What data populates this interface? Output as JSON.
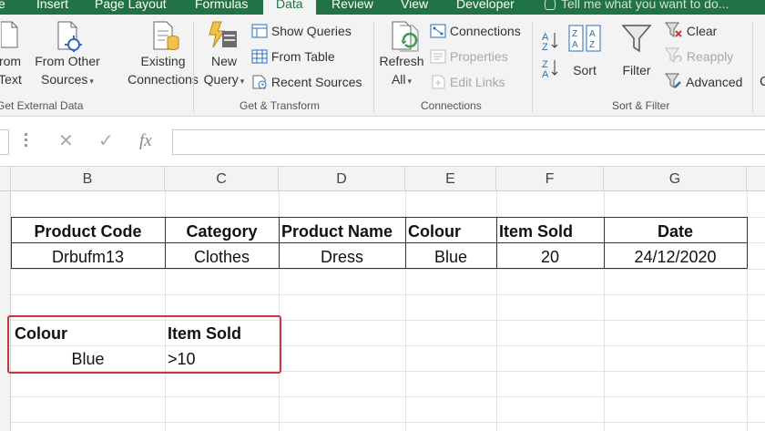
{
  "tabs": [
    {
      "label": "e"
    },
    {
      "label": "Insert"
    },
    {
      "label": "Page Layout"
    },
    {
      "label": "Formulas"
    },
    {
      "label": "Data"
    },
    {
      "label": "Review"
    },
    {
      "label": "View"
    },
    {
      "label": "Developer"
    }
  ],
  "tell_me": "Tell me what you want to do...",
  "ribbon": {
    "get_external": {
      "from_text": [
        "rom",
        "Text"
      ],
      "from_other": [
        "From Other",
        "Sources"
      ],
      "existing": [
        "Existing",
        "Connections"
      ],
      "label": "Get External Data"
    },
    "get_transform": {
      "new_query": [
        "New",
        "Query"
      ],
      "show_queries": "Show Queries",
      "from_table": "From Table",
      "recent_sources": "Recent Sources",
      "label": "Get & Transform"
    },
    "connections": {
      "refresh": [
        "Refresh",
        "All"
      ],
      "connections": "Connections",
      "properties": "Properties",
      "edit_links": "Edit Links",
      "label": "Connections"
    },
    "sort_filter": {
      "sort": "Sort",
      "filter": "Filter",
      "clear": "Clear",
      "reapply": "Reapply",
      "advanced": "Advanced",
      "label": "Sort & Filter"
    }
  },
  "formula_bar": {
    "value": ""
  },
  "columns": [
    "B",
    "C",
    "D",
    "E",
    "F",
    "G"
  ],
  "table": {
    "headers": [
      "Product Code",
      "Category",
      "Product Name",
      "Colour",
      "Item Sold",
      "Date"
    ],
    "row": [
      "Drbufm13",
      "Clothes",
      "Dress",
      "Blue",
      "20",
      "24/12/2020"
    ]
  },
  "criteria": {
    "headers": [
      "Colour",
      "Item Sold"
    ],
    "row": [
      "Blue",
      ">10"
    ]
  },
  "colors": {
    "excel_green": "#217346",
    "highlight_red": "#c9363f"
  }
}
